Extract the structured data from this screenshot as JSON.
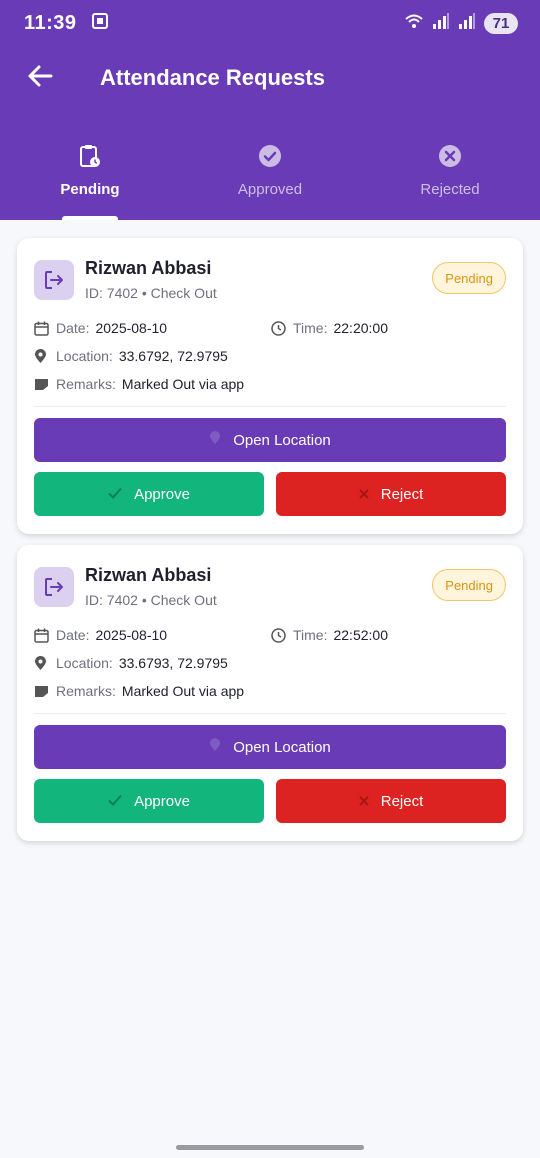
{
  "status_bar": {
    "time": "11:39",
    "battery": "71"
  },
  "header": {
    "title": "Attendance Requests"
  },
  "tabs": [
    {
      "label": "Pending",
      "icon": "clipboard-clock-icon"
    },
    {
      "label": "Approved",
      "icon": "check-circle-icon"
    },
    {
      "label": "Rejected",
      "icon": "x-circle-icon"
    }
  ],
  "requests": [
    {
      "name": "Rizwan Abbasi",
      "subtitle": "ID: 7402 • Check Out",
      "status": "Pending",
      "date_label": "Date:",
      "date": "2025-08-10",
      "time_label": "Time:",
      "time": "22:20:00",
      "location_label": "Location:",
      "location": "33.6792, 72.9795",
      "remarks_label": "Remarks:",
      "remarks": "Marked Out via app",
      "open_location_label": "Open Location",
      "approve_label": "Approve",
      "reject_label": "Reject"
    },
    {
      "name": "Rizwan Abbasi",
      "subtitle": "ID: 7402 • Check Out",
      "status": "Pending",
      "date_label": "Date:",
      "date": "2025-08-10",
      "time_label": "Time:",
      "time": "22:52:00",
      "location_label": "Location:",
      "location": "33.6793, 72.9795",
      "remarks_label": "Remarks:",
      "remarks": "Marked Out via app",
      "open_location_label": "Open Location",
      "approve_label": "Approve",
      "reject_label": "Reject"
    }
  ],
  "colors": {
    "primary": "#6a3bb7",
    "approve": "#12b67c",
    "reject": "#dd2222",
    "pending_badge": "#d9960f"
  }
}
